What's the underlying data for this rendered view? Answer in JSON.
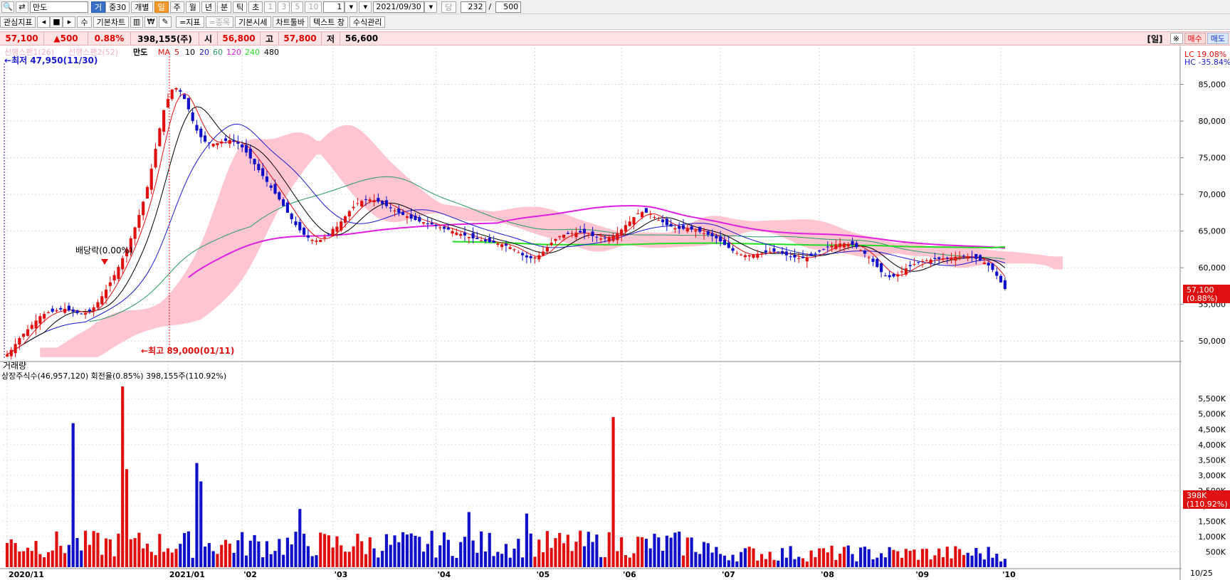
{
  "toolbar": {
    "stock_name": "만도",
    "toggle_geo": "거",
    "toggle_jung": "중30",
    "mode_individual": "개별",
    "periods": [
      "일",
      "주",
      "월",
      "년",
      "분",
      "틱",
      "초"
    ],
    "active_period": "일",
    "minutes": [
      "1",
      "3",
      "5",
      "10"
    ],
    "count_value": "1",
    "date_value": "2021/09/30",
    "dang_label": "당",
    "bars_shown": "232",
    "slash": "/",
    "bars_total": "500"
  },
  "toolbar2": {
    "interest_indicator": "관심지표",
    "su_label": "수",
    "basic_chart": "기본차트",
    "won_label": "₩",
    "indicator": "=지표",
    "item": "=종목",
    "basic_quote": "기본시세",
    "chart_toolbar": "차트툴바",
    "text_window": "텍스트 창",
    "formula_manage": "수식관리"
  },
  "price_bar": {
    "price": "57,100",
    "change": "▲500",
    "change_pct": "0.88%",
    "volume": "398,155(주)",
    "open_label": "시",
    "open": "56,800",
    "high_label": "고",
    "high": "57,800",
    "low_label": "저",
    "low": "56,600",
    "period_label": "[일]",
    "settings_icon": "※",
    "buy_label": "매수",
    "sell_label": "매도"
  },
  "colors": {
    "up": "#e01010",
    "down": "#1010c8",
    "ma5": "#e01010",
    "ma10": "#000000",
    "ma20": "#1a1ad0",
    "ma60": "#2a9a60",
    "ma120": "#e020e0",
    "ma240": "#22dd22",
    "cloud": "#ffc0cc"
  },
  "chart_data": [
    {
      "type": "candlestick",
      "title": "만도",
      "legend": {
        "span1": "선행스팬1(26)",
        "span2": "선행스팬2(52)",
        "name": "만도",
        "ma_label": "MA",
        "ma_periods": [
          "5",
          "10",
          "20",
          "60",
          "120",
          "240",
          "480"
        ]
      },
      "annotations": {
        "low": "최저 47,950(11/30)",
        "high": "최고 89,000(01/11)",
        "dividend": "배당락(0.00%)",
        "lc": "LC  19.08%",
        "hc": "HC -35.84%",
        "last_price": "57,100",
        "last_pct": "(0.88%)"
      },
      "y_ticks": [
        "85,000",
        "80,000",
        "75,000",
        "70,000",
        "65,000",
        "60,000",
        "55,000",
        "50,000"
      ],
      "ylim": [
        47500,
        90000
      ],
      "x_ticks": [
        {
          "i": 0,
          "label": "2020/11"
        },
        {
          "i": 39,
          "label": "2021/01"
        },
        {
          "i": 57,
          "label": "'02"
        },
        {
          "i": 79,
          "label": "'03"
        },
        {
          "i": 104,
          "label": "'04"
        },
        {
          "i": 128,
          "label": "'05"
        },
        {
          "i": 149,
          "label": "'06"
        },
        {
          "i": 173,
          "label": "'07"
        },
        {
          "i": 197,
          "label": "'08"
        },
        {
          "i": 220,
          "label": "'09"
        },
        {
          "i": 241,
          "label": "'10"
        }
      ],
      "x_date_label": "10/25",
      "close": [
        48200,
        48800,
        49600,
        50400,
        51000,
        51600,
        52200,
        52800,
        53400,
        53700,
        53900,
        54000,
        54200,
        54300,
        54400,
        54200,
        54000,
        53800,
        53700,
        53800,
        54100,
        54600,
        55300,
        56100,
        57000,
        58000,
        59000,
        60100,
        61300,
        62600,
        64000,
        65500,
        67200,
        69000,
        71000,
        73500,
        76200,
        79000,
        81500,
        83000,
        84300,
        84500,
        84000,
        83000,
        81600,
        80000,
        78700,
        77800,
        77200,
        77000,
        76900,
        77000,
        77200,
        77300,
        77400,
        77200,
        76900,
        76400,
        75700,
        74900,
        74100,
        73300,
        72500,
        71700,
        70900,
        70100,
        69300,
        68400,
        67500,
        66600,
        65800,
        65100,
        64500,
        64100,
        63800,
        63700,
        63800,
        64200,
        64600,
        65300,
        65600,
        66300,
        67000,
        67700,
        68300,
        68800,
        69100,
        69300,
        69300,
        69200,
        69000,
        68700,
        68400,
        68100,
        67800,
        67500,
        67200,
        67000,
        66700,
        66500,
        66300,
        66200,
        66000,
        65900,
        65700,
        65500,
        65300,
        65200,
        65000,
        64800,
        64600,
        64400,
        64200,
        64000,
        63900,
        63700,
        63600,
        63500,
        63400,
        63300,
        63200,
        63000,
        62800,
        62500,
        62100,
        61700,
        61400,
        61300,
        61400,
        61700,
        62200,
        62800,
        63400,
        63900,
        64300,
        64500,
        64600,
        64700,
        64800,
        64800,
        64700,
        64500,
        64300,
        64200,
        64000,
        64000,
        64100,
        64300,
        64700,
        65200,
        65800,
        66300,
        66900,
        67400,
        67600,
        67500,
        67300,
        66900,
        66500,
        66200,
        65800,
        65600,
        65400,
        65300,
        65300,
        65300,
        65200,
        65100,
        64900,
        64700,
        64500,
        64300,
        64000,
        63600,
        63100,
        62700,
        62300,
        62000,
        61800,
        61700,
        61700,
        61800,
        61900,
        62000,
        62100,
        62200,
        62200,
        62100,
        61900,
        61700,
        61500,
        61400,
        61300,
        61300,
        61400,
        61600,
        61900,
        62200,
        62500,
        62800,
        63000,
        63200,
        63300,
        63300,
        63200,
        63100,
        62800,
        62400,
        61900,
        61400,
        60800,
        60100,
        59400,
        58900,
        58700,
        58800,
        59100,
        59500,
        59900,
        60200,
        60500,
        60700,
        60900,
        61000,
        61100,
        61200,
        61200,
        61300,
        61300,
        61400,
        61500,
        61500,
        61600,
        61500,
        61400,
        61200,
        61000,
        60700,
        60300,
        59700,
        58900,
        58000,
        57100
      ],
      "volume_panel": {
        "title": "거래량",
        "info": "상장주식수(46,957,120) 회전율(0.85%) 398,155주(110.92%)",
        "y_ticks": [
          "5,500K",
          "5,000K",
          "4,500K",
          "4,000K",
          "3,500K",
          "3,000K",
          "2,500K",
          "2,000K",
          "1,500K",
          "1,000K",
          "500K"
        ],
        "ylim": [
          0,
          5900000
        ],
        "last_volume": "398K",
        "last_volume_pct": "(110.92%)",
        "spikes": [
          {
            "i": 16,
            "v": 4700000
          },
          {
            "i": 28,
            "v": 5900000
          },
          {
            "i": 29,
            "v": 3200000
          },
          {
            "i": 46,
            "v": 3400000
          },
          {
            "i": 47,
            "v": 2800000
          },
          {
            "i": 147,
            "v": 4900000
          },
          {
            "i": 71,
            "v": 1900000
          },
          {
            "i": 112,
            "v": 1800000
          },
          {
            "i": 126,
            "v": 1750000
          }
        ]
      }
    }
  ]
}
